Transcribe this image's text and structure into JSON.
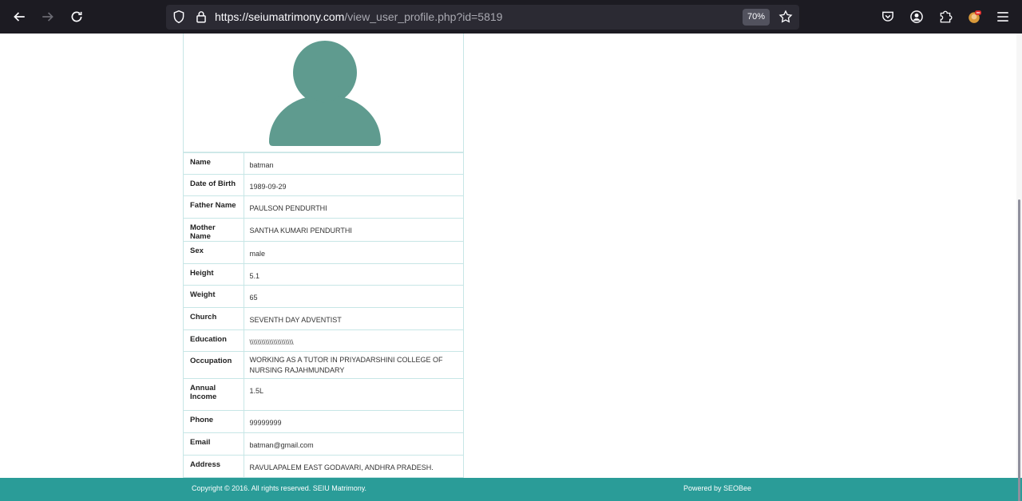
{
  "browser": {
    "url_host": "https://seiumatrimony.com",
    "url_path": "/view_user_profile.php?id=5819",
    "zoom": "70%"
  },
  "profile": {
    "rows": [
      {
        "label": "Name",
        "value": "batman"
      },
      {
        "label": "Date of Birth",
        "value": "1989-09-29"
      },
      {
        "label": "Father Name",
        "value": "PAULSON PENDURTHI"
      },
      {
        "label": "Mother Name",
        "value": "SANTHA KUMARI PENDURTHI"
      },
      {
        "label": "Sex",
        "value": "male"
      },
      {
        "label": "Height",
        "value": "5.1"
      },
      {
        "label": "Weight",
        "value": "65"
      },
      {
        "label": "Church",
        "value": "SEVENTH DAY ADVENTIST"
      },
      {
        "label": "Education",
        "value": "\\\\\\\\\\\\\\\\\\\\\\\\\\\\\\\\\\\\\\\\\\\\"
      },
      {
        "label": "Occupation",
        "value": "WORKING AS A TUTOR IN PRIYADARSHINI COLLEGE OF NURSING RAJAHMUNDARY"
      },
      {
        "label": "Annual Income",
        "value": "1.5L"
      },
      {
        "label": "Phone",
        "value": "99999999"
      },
      {
        "label": "Email",
        "value": "batman@gmail.com"
      },
      {
        "label": "Address",
        "value": "RAVULAPALEM EAST GODAVARI, ANDHRA PRADESH."
      }
    ]
  },
  "footer": {
    "copyright": "Copyright © 2016. All rights reserved. SEIU Matrimony.",
    "powered_by": "Powered by SEOBee"
  },
  "colors": {
    "footer_bg": "#2a9c98",
    "avatar": "#5f9b8f",
    "toolbar_bg": "#1c1b22"
  }
}
